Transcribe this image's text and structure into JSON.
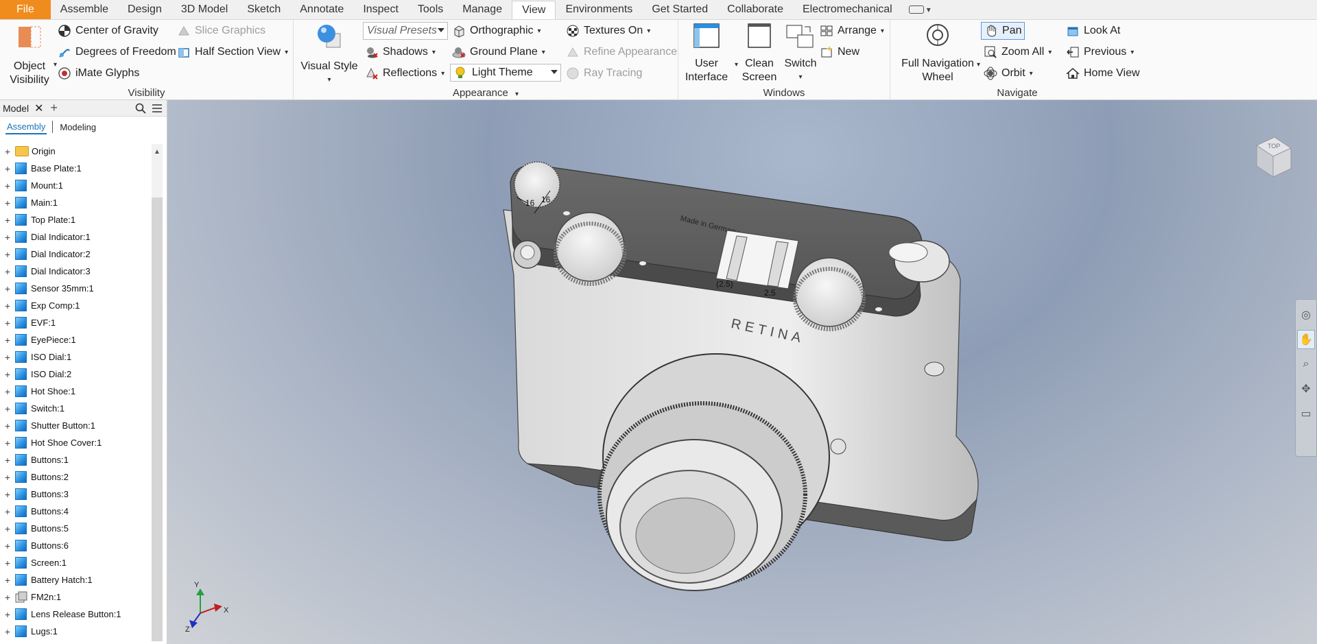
{
  "tabs": [
    {
      "label": "File",
      "kind": "file"
    },
    {
      "label": "Assemble"
    },
    {
      "label": "Design"
    },
    {
      "label": "3D Model"
    },
    {
      "label": "Sketch"
    },
    {
      "label": "Annotate"
    },
    {
      "label": "Inspect"
    },
    {
      "label": "Tools"
    },
    {
      "label": "Manage"
    },
    {
      "label": "View",
      "active": true
    },
    {
      "label": "Environments"
    },
    {
      "label": "Get Started"
    },
    {
      "label": "Collaborate"
    },
    {
      "label": "Electromechanical"
    }
  ],
  "ribbon": {
    "visibility": {
      "title": "Visibility",
      "object_visibility_line1": "Object",
      "object_visibility_line2": "Visibility",
      "center_of_gravity": "Center of Gravity",
      "degrees_of_freedom": "Degrees of Freedom",
      "imate_glyphs": "iMate Glyphs",
      "slice_graphics": "Slice Graphics",
      "half_section_view": "Half Section View"
    },
    "appearance": {
      "title": "Appearance",
      "visual_style": "Visual Style",
      "visual_presets": "Visual Presets",
      "shadows": "Shadows",
      "reflections": "Reflections",
      "orthographic": "Orthographic",
      "ground_plane": "Ground Plane",
      "light_theme": "Light Theme",
      "textures_on": "Textures On",
      "refine_appearance": "Refine Appearance",
      "ray_tracing": "Ray Tracing"
    },
    "windows": {
      "title": "Windows",
      "user_interface_line1": "User",
      "user_interface_line2": "Interface",
      "clean_screen_line1": "Clean",
      "clean_screen_line2": "Screen",
      "switch": "Switch",
      "arrange": "Arrange",
      "new": "New"
    },
    "navigate": {
      "title": "Navigate",
      "full_nav_line1": "Full Navigation",
      "full_nav_line2": "Wheel",
      "pan": "Pan",
      "zoom_all": "Zoom All",
      "orbit": "Orbit",
      "look_at": "Look At",
      "previous": "Previous",
      "home_view": "Home View"
    }
  },
  "browser": {
    "title": "Model",
    "modes": [
      "Assembly",
      "Modeling"
    ],
    "items": [
      {
        "label": "Origin",
        "icon": "folder"
      },
      {
        "label": "Base Plate:1"
      },
      {
        "label": "Mount:1"
      },
      {
        "label": "Main:1"
      },
      {
        "label": "Top Plate:1"
      },
      {
        "label": "Dial Indicator:1"
      },
      {
        "label": "Dial Indicator:2"
      },
      {
        "label": "Dial Indicator:3"
      },
      {
        "label": "Sensor 35mm:1"
      },
      {
        "label": "Exp Comp:1"
      },
      {
        "label": "EVF:1"
      },
      {
        "label": "EyePiece:1"
      },
      {
        "label": "ISO Dial:1"
      },
      {
        "label": "ISO Dial:2"
      },
      {
        "label": "Hot Shoe:1"
      },
      {
        "label": "Switch:1"
      },
      {
        "label": "Shutter Button:1"
      },
      {
        "label": "Hot Shoe Cover:1"
      },
      {
        "label": "Buttons:1"
      },
      {
        "label": "Buttons:2"
      },
      {
        "label": "Buttons:3"
      },
      {
        "label": "Buttons:4"
      },
      {
        "label": "Buttons:5"
      },
      {
        "label": "Buttons:6"
      },
      {
        "label": "Screen:1"
      },
      {
        "label": "Battery Hatch:1"
      },
      {
        "label": "FM2n:1",
        "icon": "subassembly"
      },
      {
        "label": "Lens Release Button:1"
      },
      {
        "label": "Lugs:1"
      }
    ]
  },
  "viewport": {
    "dim_left": "16",
    "dim_right": "16",
    "dim_paren": "(2.5)",
    "dim_plain": "2.5",
    "engraving": "Made in Germany",
    "brand": "RETINA",
    "viewcube_face": "TOP",
    "axis_x": "X",
    "axis_y": "Y",
    "axis_z": "Z"
  },
  "colors": {
    "file_tab": "#f08c1e",
    "accent_blue": "#1a73b8",
    "part_cube": "#2a8fe0"
  }
}
